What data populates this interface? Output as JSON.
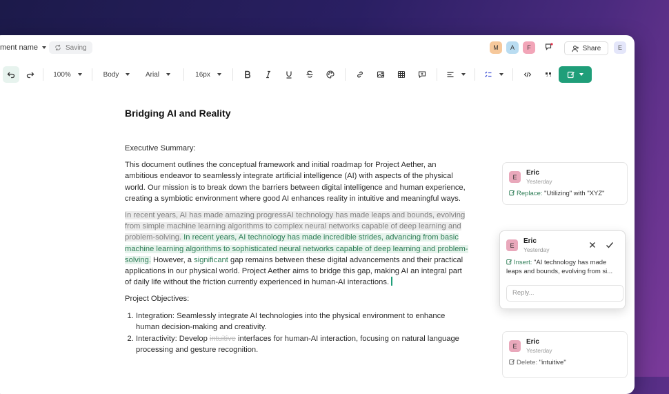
{
  "header": {
    "doc_name": "ment name",
    "saving": "Saving",
    "avatars": [
      "M",
      "A",
      "F"
    ],
    "share": "Share",
    "user": "E"
  },
  "toolbar": {
    "zoom": "100%",
    "style": "Body",
    "font": "Arial",
    "size": "16px",
    "icons": [
      "undo-icon",
      "redo-icon",
      "bold-icon",
      "italic-icon",
      "underline-icon",
      "strikethrough-icon",
      "palette-icon",
      "link-icon",
      "image-icon",
      "table-icon",
      "comment-icon",
      "align-icon",
      "checklist-icon",
      "code-icon",
      "quote-icon",
      "more-icon",
      "ai-edit-icon"
    ]
  },
  "doc": {
    "title": "Bridging AI and Reality",
    "exec_heading": "Executive Summary:",
    "p1": "This document outlines the conceptual framework and initial roadmap for Project Aether, an ambitious endeavor to seamlessly integrate artificial intelligence (AI) with aspects of the physical world. Our mission is to break down the barriers between digital intelligence and human experience, creating a symbiotic environment where good AI enhances reality in intuitive and meaningful ways.",
    "p2_old": "In recent years, AI has made amazing progressAI technology has made leaps and bounds, evolving from simple machine learning algorithms to complex neural networks capable of deep learning and problem-solving.",
    "p2_new": " In recent years, AI technology has made incredible strides, advancing from basic machine learning algorithms to sophisticated neural networks capable of deep learning and problem-solving.",
    "p2_mid": " However, a ",
    "p2_ins": "significant",
    "p2_rest": " gap remains between these digital advancements and their practical applications in our physical world. Project Aether aims to bridge this gap, making AI an integral part of daily life without the friction currently experienced in human-AI interactions.",
    "objectives_heading": "Project Objectives:",
    "obj1": "Integration: Seamlessly integrate AI technologies into the physical environment to enhance human decision-making and creativity.",
    "obj2_a": "Interactivity: Develop ",
    "obj2_del": "intuitive",
    "obj2_b": " interfaces for human-AI interaction, focusing on natural language processing and gesture recognition."
  },
  "comments": [
    {
      "avatar": "E",
      "name": "Eric",
      "time": "Yesterday",
      "action": "Replace:",
      "text": "\"Utilizing\" with \"XYZ\""
    },
    {
      "avatar": "E",
      "name": "Eric",
      "time": "Yesterday",
      "action": "Insert:",
      "text": "\"AI technology has made leaps and bounds, evolving from si...",
      "reply_placeholder": "Reply..."
    },
    {
      "avatar": "E",
      "name": "Eric",
      "time": "Yesterday",
      "action": "Delete:",
      "text": "\"intuitive\""
    }
  ],
  "colors": {
    "accent": "#1f9e79",
    "insert_bg": "#e6f3ec",
    "old_bg": "#ececec"
  }
}
